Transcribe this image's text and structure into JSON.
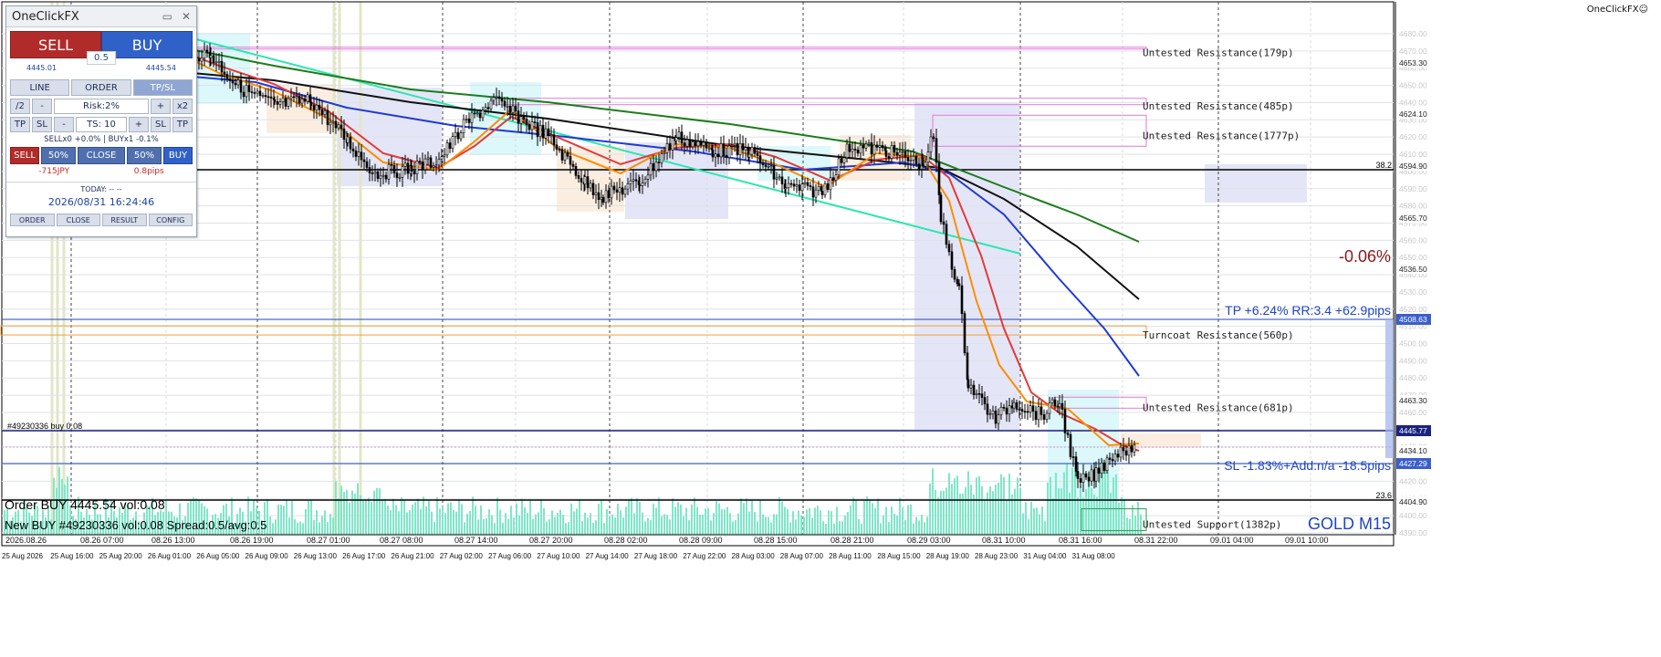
{
  "panel": {
    "title": "OneClickFX",
    "minimize": "▭",
    "close": "✕",
    "sell_label": "SELL",
    "buy_label": "BUY",
    "lot": "0.5",
    "sell_price": "4445.01",
    "buy_price": "4445.54",
    "tabs": [
      "LINE",
      "ORDER",
      "TP/SL"
    ],
    "half": "/2",
    "minus": "-",
    "risk": "Risk:2%",
    "plus": "+",
    "double": "x2",
    "tp": "TP",
    "sl": "SL",
    "ts": "TS: 10",
    "positions": "SELLx0 +0.0% | BUYx1 -0.1%",
    "close_sell": "SELL",
    "pct50a": "50%",
    "close_all": "CLOSE",
    "pct50b": "50%",
    "close_buy": "BUY",
    "pl_money": "-715JPY",
    "pl_pips": "0.8pips",
    "today": "TODAY: -- --",
    "datetime": "2026/08/31  16:24:46",
    "footer": [
      "ORDER",
      "CLOSE",
      "RESULT",
      "CONFIG"
    ]
  },
  "brand": "OneClickFX☺",
  "symbol": "GOLD M15",
  "change": "-0.06%",
  "tp_text": "TP +6.24% RR:3.4 +62.9pips",
  "sl_text": "SL -1.83%+Add:n/a -18.5pips",
  "order_line_label": "#49230336 buy 0.08",
  "order_text": "Order BUY 4445.54 vol:0.08",
  "new_buy_text": "New BUY #49230336 vol:0.08 Spread:0.5/avg:0.5",
  "fib_top": "38.2",
  "fib_bottom": "23.6",
  "zones": [
    {
      "text": "Untested Resistance(179p)",
      "price": 4669
    },
    {
      "text": "Untested Resistance(485p)",
      "price": 4638
    },
    {
      "text": "Untested Resistance(1777p)",
      "price": 4621
    },
    {
      "text": "Turncoat Resistance(560p)",
      "price": 4505
    },
    {
      "text": "Untested Resistance(681p)",
      "price": 4463
    },
    {
      "text": "Untested Support(1382p)",
      "price": 4395
    }
  ],
  "price_axis": {
    "ticks": [
      "4680.00",
      "4670.00",
      "4660.00",
      "4650.00",
      "4640.00",
      "4630.00",
      "4620.00",
      "4610.00",
      "4600.00",
      "4590.00",
      "4580.00",
      "4570.00",
      "4560.00",
      "4550.00",
      "4540.00",
      "4530.00",
      "4520.00",
      "4510.00",
      "4500.00",
      "4490.00",
      "4480.00",
      "4470.00",
      "4460.00",
      "4450.00",
      "4440.00",
      "4430.00",
      "4420.00",
      "4410.00",
      "4400.00",
      "4390.00"
    ],
    "labels": [
      "4653.30",
      "4624.10",
      "4594.90",
      "4565.70",
      "4536.50",
      "4507.30",
      "4463.30",
      "4434.10",
      "4404.90"
    ],
    "tp_badge": "4508.63",
    "bid_badge": "4445.77",
    "sl_badge": "4427.29"
  },
  "time_axis_top": [
    "2026.08.26",
    "08.26 07:00",
    "08.26 13:00",
    "08.26 19:00",
    "08.27 01:00",
    "08.27 08:00",
    "08.27 14:00",
    "08.27 20:00",
    "08.28 02:00",
    "08.28 09:00",
    "08.28 15:00",
    "08.28 21:00",
    "08.29 03:00",
    "08.31 10:00",
    "08.31 16:00",
    "08.31 22:00",
    "09.01 04:00",
    "09.01 10:00"
  ],
  "time_axis_bottom": [
    "25 Aug 2026",
    "25 Aug 16:00",
    "25 Aug 20:00",
    "26 Aug 01:00",
    "26 Aug 05:00",
    "26 Aug 09:00",
    "26 Aug 13:00",
    "26 Aug 17:00",
    "26 Aug 21:00",
    "27 Aug 02:00",
    "27 Aug 06:00",
    "27 Aug 10:00",
    "27 Aug 14:00",
    "27 Aug 18:00",
    "27 Aug 22:00",
    "28 Aug 03:00",
    "28 Aug 07:00",
    "28 Aug 11:00",
    "28 Aug 15:00",
    "28 Aug 19:00",
    "28 Aug 23:00",
    "31 Aug 04:00",
    "31 Aug 08:00"
  ],
  "colors": {
    "bull_candle": "#000000",
    "ema_fast": "#ff8c00",
    "ema_mid": "#e53935",
    "ma_blue": "#1f3ad6",
    "ma_black": "#111111",
    "ma_green": "#1b7d1b",
    "trend": "#2ee6b0",
    "zone_line": "#e07ad9",
    "volume": "#7fe7c8",
    "tp_line": "#1f46c0",
    "box_blue": "#e4e6f7",
    "box_tan": "#fbeee1",
    "box_cyan": "#dcf8fb"
  }
}
